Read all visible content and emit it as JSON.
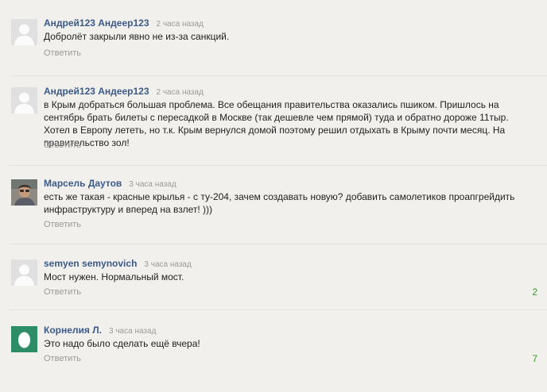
{
  "reply_label": "Ответить",
  "colors": {
    "author": "#3b5a8a",
    "muted": "#9a9a9a",
    "rating": "#3b9a2b",
    "background": "#f1f0ed"
  },
  "comments": [
    {
      "author": "Андрей123 Андеер123",
      "time": "2 часа назад",
      "text": "Добролёт закрыли явно не из-за санкций.",
      "avatar": "default-avatar-icon",
      "rating": ""
    },
    {
      "author": "Андрей123 Андеер123",
      "time": "2 часа назад",
      "text": "в Крым добраться большая проблема. Все обещания правительства оказались пшиком. Пришлось на сентябрь брать билеты с пересадкой в Москве (так дешевле чем прямой) туда и обратно дороже 11тыр. Хотел в Европу лететь, но т.к. Крым вернулся домой поэтому решил отдыхать в Крыму почти месяц. На правительство зол!",
      "avatar": "default-avatar-icon",
      "rating": ""
    },
    {
      "author": "Марсель Даутов",
      "time": "3 часа назад",
      "text": "есть же такая - красные крылья - с ту-204, зачем создавать новую? добавить самолетиков проапгрейдить инфраструктуру и вперед на взлет! )))",
      "avatar": "user-photo-icon",
      "rating": ""
    },
    {
      "author": "semyen semynovich",
      "time": "3 часа назад",
      "text": "Мост нужен. Нормальный мост.",
      "avatar": "default-avatar-icon",
      "rating": "2"
    },
    {
      "author": "Корнелия Л.",
      "time": "3 часа назад",
      "text": "Это надо было сделать ещё вчера!",
      "avatar": "egg-avatar-icon",
      "rating": "7"
    }
  ]
}
